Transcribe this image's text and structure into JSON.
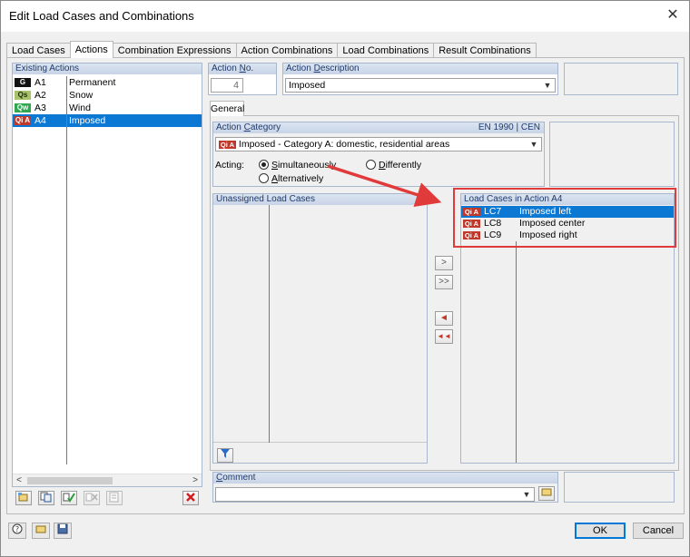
{
  "window": {
    "title": "Edit Load Cases and Combinations",
    "close_glyph": "✕"
  },
  "tabs": [
    "Load Cases",
    "Actions",
    "Combination Expressions",
    "Action Combinations",
    "Load Combinations",
    "Result Combinations"
  ],
  "existing_actions": {
    "header": "Existing Actions",
    "items": [
      {
        "badge": "G",
        "badge_bg": "#111111",
        "badge_fg": "#ffffff",
        "id": "A1",
        "desc": "Permanent"
      },
      {
        "badge": "Qs",
        "badge_bg": "#a8c26b",
        "badge_fg": "#1b2a08",
        "id": "A2",
        "desc": "Snow"
      },
      {
        "badge": "Qw",
        "badge_bg": "#2fa84f",
        "badge_fg": "#ffffff",
        "id": "A3",
        "desc": "Wind"
      },
      {
        "badge": "Qi A",
        "badge_bg": "#c0392b",
        "badge_fg": "#ffffff",
        "id": "A4",
        "desc": "Imposed"
      }
    ],
    "scroll_left": "<",
    "scroll_right": ">"
  },
  "action_no": {
    "label_prefix": "Action ",
    "label_u": "N",
    "label_suffix": "o.",
    "value": "4"
  },
  "action_desc": {
    "label_prefix": "Action ",
    "label_u": "D",
    "label_suffix": "escription",
    "value": "Imposed"
  },
  "inner_tab": "General",
  "category": {
    "label_prefix": "Action ",
    "label_u": "C",
    "label_suffix": "ategory",
    "norm": "EN 1990 | CEN",
    "badge": "Qi A",
    "value": "Imposed - Category A: domestic, residential areas"
  },
  "acting": {
    "label": "Acting:",
    "opt_simul_u": "S",
    "opt_simul_rest": "imultaneously",
    "opt_diff_u": "D",
    "opt_diff_rest": "ifferently",
    "opt_alt_u": "A",
    "opt_alt_rest": "lternatively"
  },
  "unassigned": {
    "header": "Unassigned Load Cases"
  },
  "assigned": {
    "header": "Load Cases in Action A4",
    "rows": [
      {
        "badge": "Qi A",
        "id": "LC7",
        "desc": "Imposed left"
      },
      {
        "badge": "Qi A",
        "id": "LC8",
        "desc": "Imposed center"
      },
      {
        "badge": "Qi A",
        "id": "LC9",
        "desc": "Imposed right"
      }
    ]
  },
  "transfer": {
    "one_right": ">",
    "all_right": ">>",
    "one_left": "◄",
    "all_left": "◄◄"
  },
  "comment": {
    "label_u": "C",
    "label_rest": "omment",
    "value": ""
  },
  "footer": {
    "ok": "OK",
    "cancel": "Cancel"
  },
  "accent": {
    "selection": "#0b78d4",
    "highlight_frame": "#e03a3a"
  }
}
